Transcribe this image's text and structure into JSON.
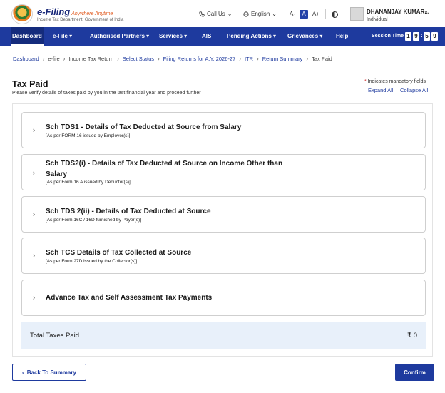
{
  "header": {
    "logo_main": "e-Filing",
    "logo_tagline": "Anywhere Anytime",
    "logo_sub": "Income Tax Department, Government of India",
    "call_us": "Call Us",
    "language": "English",
    "font_decrease": "A-",
    "font_normal": "A",
    "font_increase": "A+",
    "user_name": "DHANANJAY KUMAR...",
    "user_role": "Individual"
  },
  "nav": {
    "items": [
      {
        "label": "Dashboard"
      },
      {
        "label": "e-File ▾"
      },
      {
        "label": "Authorised Partners ▾"
      },
      {
        "label": "Services ▾"
      },
      {
        "label": "AIS"
      },
      {
        "label": "Pending Actions ▾"
      },
      {
        "label": "Grievances ▾"
      },
      {
        "label": "Help"
      }
    ],
    "session_label": "Session Time",
    "session_digits": [
      "1",
      "9",
      "5",
      "9"
    ]
  },
  "breadcrumb": [
    {
      "label": "Dashboard"
    },
    {
      "label": "e-file"
    },
    {
      "label": "Income Tax Return"
    },
    {
      "label": "Select Status"
    },
    {
      "label": "Filing Returns for A.Y. 2026-27"
    },
    {
      "label": "ITR"
    },
    {
      "label": "Return Summary"
    },
    {
      "label": "Tax Paid"
    }
  ],
  "page": {
    "title": "Tax Paid",
    "subtitle": "Please verify details of taxes paid by you in the last financial year and proceed further",
    "mandatory_note": "Indicates mandatory fields",
    "expand_all": "Expand All",
    "collapse_all": "Collapse All"
  },
  "sections": [
    {
      "title": "Sch TDS1 - Details of Tax Deducted at Source from Salary",
      "subtitle": "[As per FORM 16 issued by Employer(s)]"
    },
    {
      "title": "Sch TDS2(i) - Details of Tax Deducted at Source on Income Other than Salary",
      "subtitle": "[As per Form 16 A issued by Deductor(s)]"
    },
    {
      "title": "Sch TDS 2(ii) - Details of Tax Deducted at Source",
      "subtitle": "[As per Form 16C / 16D furnished by Payer(s)]"
    },
    {
      "title": "Sch TCS Details of Tax Collected at Source",
      "subtitle": "[As per Form 27D issued by the Collector(s)]"
    },
    {
      "title": "Advance Tax and Self Assessment Tax Payments",
      "subtitle": ""
    }
  ],
  "total": {
    "label": "Total Taxes Paid",
    "value": "₹ 0"
  },
  "buttons": {
    "back": "Back To Summary",
    "confirm": "Confirm"
  },
  "colors": {
    "primary": "#1e3a9e",
    "total_bg": "#e8f0fa"
  }
}
